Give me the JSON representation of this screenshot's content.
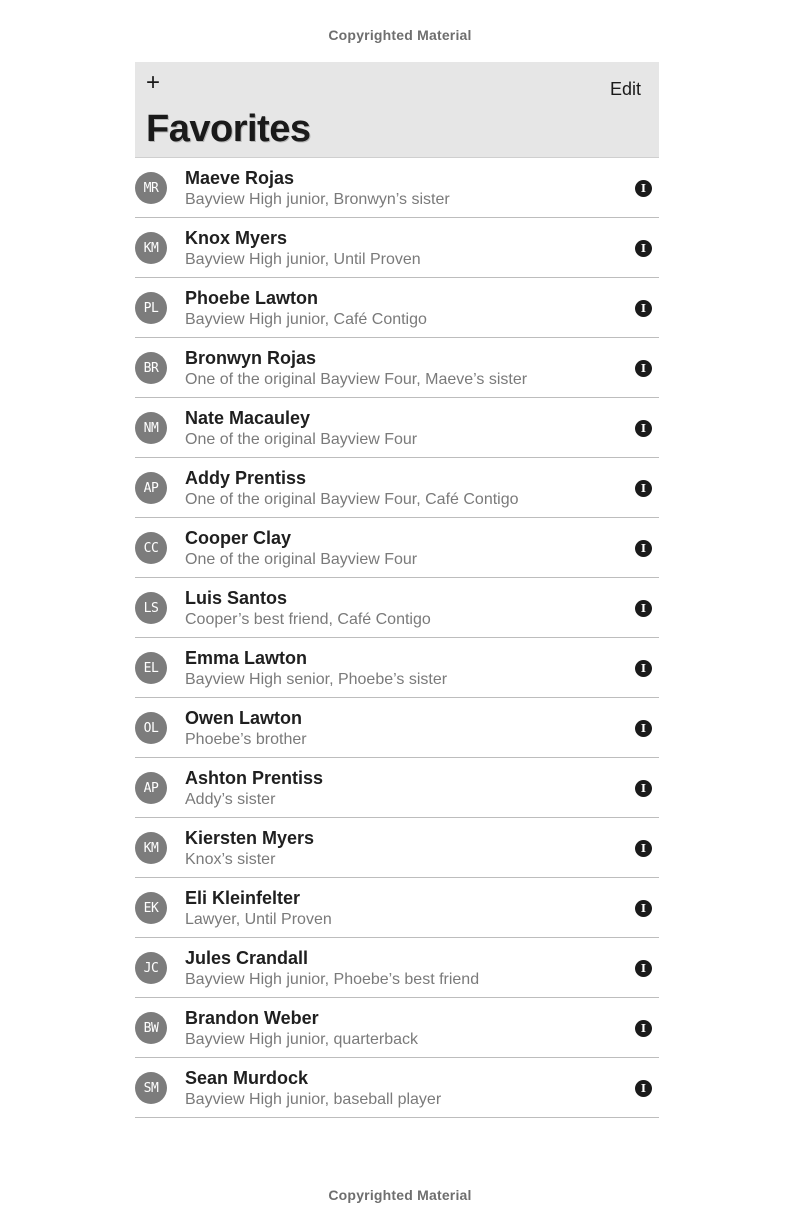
{
  "watermark": {
    "top": "Copyrighted Material",
    "bottom": "Copyrighted Material"
  },
  "header": {
    "add_icon": "+",
    "edit_label": "Edit",
    "title": "Favorites"
  },
  "info_icon_glyph": "I",
  "contacts": [
    {
      "initials": "MR",
      "name": "Maeve Rojas",
      "desc": "Bayview High junior, Bronwyn’s sister"
    },
    {
      "initials": "KM",
      "name": "Knox Myers",
      "desc": "Bayview High junior, Until Proven"
    },
    {
      "initials": "PL",
      "name": "Phoebe Lawton",
      "desc": "Bayview High junior, Café Contigo"
    },
    {
      "initials": "BR",
      "name": "Bronwyn Rojas",
      "desc": "One of the original Bayview Four, Maeve’s sister"
    },
    {
      "initials": "NM",
      "name": "Nate Macauley",
      "desc": "One of the original Bayview Four"
    },
    {
      "initials": "AP",
      "name": "Addy Prentiss",
      "desc": "One of the original Bayview Four, Café Contigo"
    },
    {
      "initials": "CC",
      "name": "Cooper Clay",
      "desc": "One of the original Bayview Four"
    },
    {
      "initials": "LS",
      "name": "Luis Santos",
      "desc": "Cooper’s best friend, Café Contigo"
    },
    {
      "initials": "EL",
      "name": "Emma Lawton",
      "desc": "Bayview High senior, Phoebe’s sister"
    },
    {
      "initials": "OL",
      "name": "Owen Lawton",
      "desc": "Phoebe’s brother"
    },
    {
      "initials": "AP",
      "name": "Ashton Prentiss",
      "desc": "Addy’s sister"
    },
    {
      "initials": "KM",
      "name": "Kiersten Myers",
      "desc": "Knox’s sister"
    },
    {
      "initials": "EK",
      "name": "Eli Kleinfelter",
      "desc": "Lawyer, Until Proven"
    },
    {
      "initials": "JC",
      "name": "Jules Crandall",
      "desc": "Bayview High junior, Phoebe’s best friend"
    },
    {
      "initials": "BW",
      "name": "Brandon Weber",
      "desc": "Bayview High junior, quarterback"
    },
    {
      "initials": "SM",
      "name": "Sean Murdock",
      "desc": "Bayview High junior, baseball player"
    }
  ]
}
